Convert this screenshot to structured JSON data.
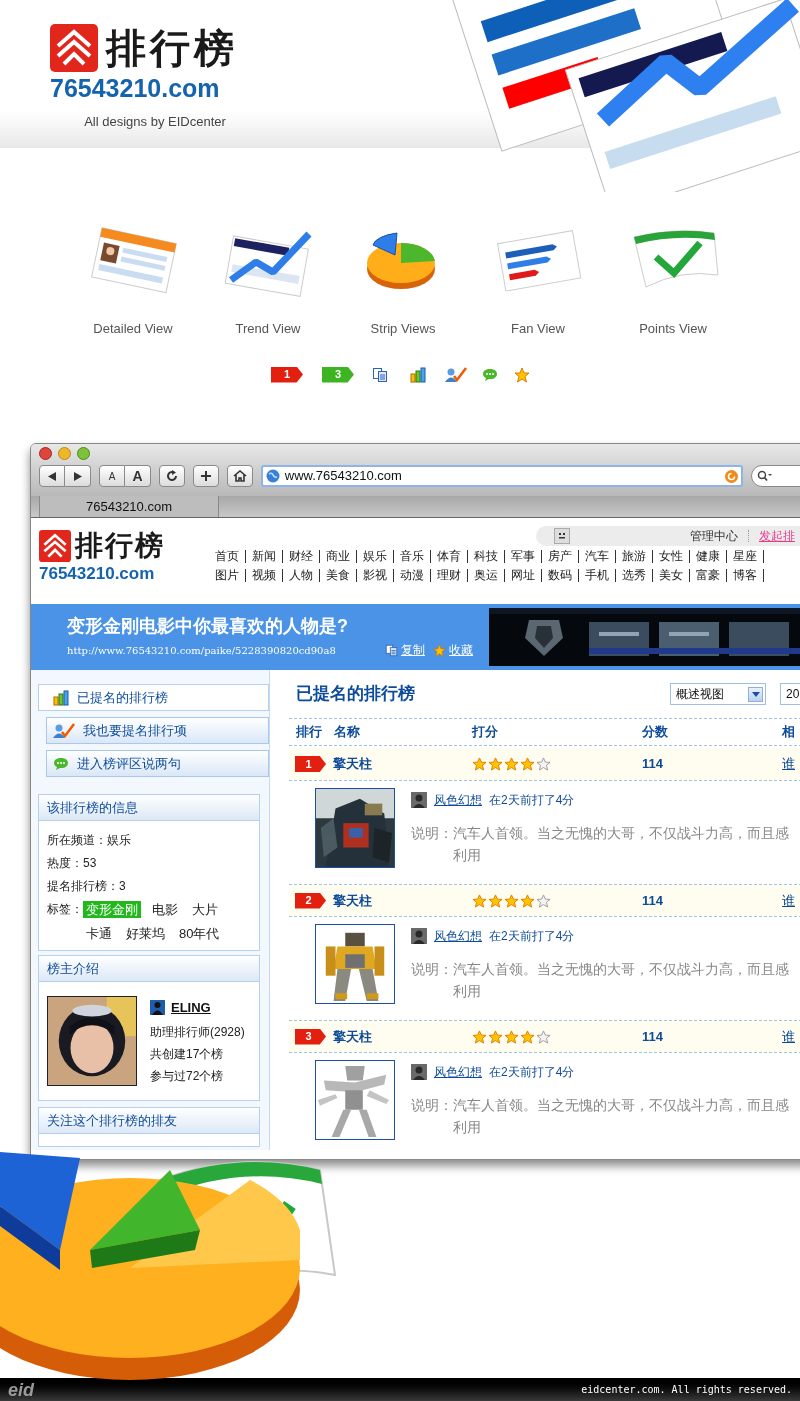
{
  "header": {
    "logo_text": "排行榜",
    "logo_domain": "76543210.com",
    "credit": "All designs by EIDcenter"
  },
  "views": [
    {
      "label": "Detailed View",
      "kind": "detailed"
    },
    {
      "label": "Trend View",
      "kind": "trend"
    },
    {
      "label": "Strip Views",
      "kind": "pie"
    },
    {
      "label": "Fan View",
      "kind": "fan"
    },
    {
      "label": "Points View",
      "kind": "check"
    }
  ],
  "icon_samples": [
    {
      "kind": "badge",
      "text": "1",
      "color": "#e3200f"
    },
    {
      "kind": "badge",
      "text": "3",
      "color": "#3db522"
    },
    {
      "kind": "copy"
    },
    {
      "kind": "bars"
    },
    {
      "kind": "user-check"
    },
    {
      "kind": "chat"
    },
    {
      "kind": "star"
    }
  ],
  "browser": {
    "text_size_buttons": [
      "A",
      "A"
    ],
    "url": "www.76543210.com",
    "tab": "76543210.com"
  },
  "site": {
    "logo_text": "排行榜",
    "logo_domain": "76543210.com",
    "user_links": [
      "管理中心",
      "发起排"
    ],
    "nav_rows": [
      [
        "首页",
        "新闻",
        "财经",
        "商业",
        "娱乐",
        "音乐",
        "体育",
        "科技",
        "军事",
        "房产",
        "汽车",
        "旅游",
        "女性",
        "健康",
        "星座"
      ],
      [
        "图片",
        "视频",
        "人物",
        "美食",
        "影视",
        "动漫",
        "理财",
        "奥运",
        "网址",
        "数码",
        "手机",
        "选秀",
        "美女",
        "富豪",
        "博客"
      ]
    ]
  },
  "banner": {
    "title": "变形金刚电影中你最喜欢的人物是?",
    "url": "http://www.76543210.com/paike/5228390820cd90a8",
    "actions": [
      {
        "kind": "copy",
        "label": "复制"
      },
      {
        "kind": "star",
        "label": "收藏"
      }
    ]
  },
  "sidebar": {
    "menu": [
      {
        "label": "已提名的排行榜",
        "kind": "bars",
        "selected": true
      },
      {
        "label": "我也要提名排行项",
        "kind": "user-check",
        "selected": false
      },
      {
        "label": "进入榜评区说两句",
        "kind": "chat",
        "selected": false
      }
    ],
    "info": {
      "title": "该排行榜的信息",
      "lines": [
        "所在频道：娱乐",
        "热度：53",
        "提名排行榜：3"
      ],
      "tags_label": "标签：",
      "tags": [
        {
          "text": "变形金刚",
          "selected": true
        },
        {
          "text": "电影",
          "selected": false
        },
        {
          "text": "大片",
          "selected": false
        },
        {
          "text": "卡通",
          "selected": false
        },
        {
          "text": "好莱坞",
          "selected": false
        },
        {
          "text": "80年代",
          "selected": false
        }
      ]
    },
    "owner": {
      "title": "榜主介绍",
      "name": "ELING",
      "lines": [
        "助理排行师(2928)",
        "共创建17个榜",
        "参与过72个榜"
      ]
    },
    "followers": {
      "title": "关注这个排行榜的排友"
    }
  },
  "main": {
    "title": "已提名的排行榜",
    "view_select": "概述视图",
    "second_select": "20",
    "columns": [
      "排行",
      "名称",
      "打分",
      "分数",
      "相"
    ],
    "rows": [
      {
        "rank": "1",
        "name": "擎天柱",
        "stars": 4,
        "score": "114",
        "link": "谁",
        "reviewer": "风色幻想",
        "review": "在2天前打了4分",
        "description_label": "说明：",
        "description_lines": [
          "汽车人首领。当之无愧的大哥，不仅战斗力高，而且感",
          "利用"
        ]
      },
      {
        "rank": "2",
        "name": "擎天柱",
        "stars": 4,
        "score": "114",
        "link": "谁",
        "reviewer": "风色幻想",
        "review": "在2天前打了4分",
        "description_label": "说明：",
        "description_lines": [
          "汽车人首领。当之无愧的大哥，不仅战斗力高，而且感",
          "利用"
        ]
      },
      {
        "rank": "3",
        "name": "擎天柱",
        "stars": 4,
        "score": "114",
        "link": "谁",
        "reviewer": "风色幻想",
        "review": "在2天前打了4分",
        "description_label": "说明：",
        "description_lines": [
          "汽车人首领。当之无愧的大哥，不仅战斗力高，而且感",
          "利用"
        ]
      }
    ]
  },
  "footer": {
    "logo": "eid",
    "copyright": "eidcenter.com. All rights reserved."
  }
}
